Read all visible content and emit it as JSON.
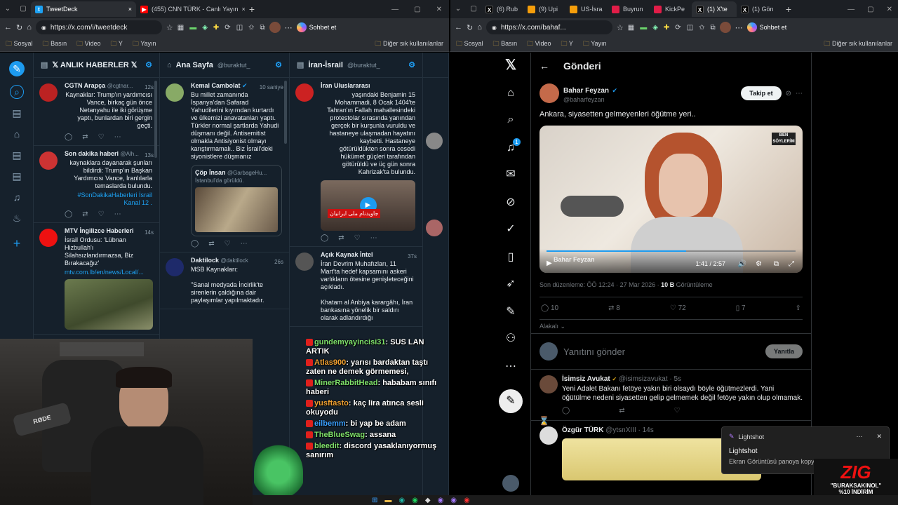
{
  "left_browser": {
    "tabs": [
      {
        "title": "TweetDeck",
        "active": true,
        "fav": "#1da1f2"
      },
      {
        "title": "(455) CNN TÜRK - Canlı Yayın",
        "active": false,
        "fav": "#ff0000"
      }
    ],
    "url": "https://x.com/i/tweetdeck",
    "copilot": "Sohbet et",
    "bookmarks": [
      "Sosyal",
      "Basın",
      "Video",
      "Y",
      "Yayın"
    ],
    "other_bookmarks": "Diğer sık kullanılanlar"
  },
  "right_browser": {
    "tabs": [
      {
        "title": "(6) Rub",
        "fav": "#000"
      },
      {
        "title": "(9) Upi",
        "fav": "#f59e0b"
      },
      {
        "title": "US-İsra",
        "fav": "#f59e0b"
      },
      {
        "title": "Buyrun",
        "fav": "#e11d48"
      },
      {
        "title": "KickPe",
        "fav": "#e11d48"
      },
      {
        "title": "(1) X'te",
        "fav": "#000"
      },
      {
        "title": "(1) Gön",
        "fav": "#000"
      }
    ],
    "url": "https://x.com/bahaf...",
    "copilot": "Sohbet et",
    "bookmarks": [
      "Sosyal",
      "Basın",
      "Video",
      "Y",
      "Yayın"
    ],
    "other_bookmarks": "Diğer sık kullanılanlar"
  },
  "tweetdeck": {
    "columns": [
      {
        "title": "ANLIK HABERLER",
        "handle": "",
        "tweets": [
          {
            "name": "CGTN Arapça",
            "handle": "@cgtnar...",
            "time": "12s",
            "text": "Kaynaklar: Trump'ın yardımcısı Vance, birkaç gün önce Netanyahu ile iki görüşme yaptı, bunlardan biri gergin geçti.",
            "rtl": true,
            "avatar": "#b22"
          },
          {
            "name": "Son dakika haberi",
            "handle": "@Alh...",
            "time": "13s",
            "text": "kaynaklara dayanarak şunları bildirdi: Trump'ın Başkan Yardımcısı Vance, İranlılarla temaslarda bulundu.",
            "link": "#SonDakikaHaberleri İsrail Kanal 12 .",
            "rtl": true,
            "avatar": "#c33"
          },
          {
            "name": "MTV İngilizce Haberleri",
            "handle": "...",
            "time": "14s",
            "text": "İsrail Ordusu: 'Lübnan Hizbullah'ı Silahsızlandırmazsa, Biz Bırakacağız'",
            "link": "mtv.com.lb/en/news/Local/...",
            "rtl": false,
            "avatar": "#e11"
          }
        ]
      },
      {
        "title": "Ana Sayfa",
        "handle": "@buraktut_",
        "tweets": [
          {
            "name": "Kemal Cambolat",
            "handle": "",
            "time": "10 saniye",
            "text": "Bu millet zamanında İspanya'dan Safarad Yahudilerini kıyımdan kurtardı ve ülkemizi anavatanları yaptı. Türkler normal şartlarda Yahudi düşmanı değil. Antisemitist olmakla Antisiyonist olmayı karıştırmamalı.. Biz İsrail'deki siyonistlere düşmanız",
            "rtl": false,
            "avatar": "#8a6"
          },
          {
            "name": "Daktilock",
            "handle": "@daktilock",
            "time": "26s",
            "text": "MSB Kaynakları:\n\n\"Sanal medyada İncirlik'te sirenlerin çaldığına dair paylaşımlar yapılmaktadır.",
            "rtl": false,
            "avatar": "#1e2a6a"
          }
        ],
        "quote": {
          "name": "Çöp İnsan",
          "handle": "@GarbageHu...",
          "text": "İstanbul'da görüldü."
        }
      },
      {
        "title": "İran-İsrail",
        "handle": "@buraktut_",
        "tweets": [
          {
            "name": "İran Uluslararası",
            "handle": "",
            "time": "",
            "text": "yaşındaki Benjamin 15 Mohammadi, 8 Ocak 1404'te Tahran'ın Fallah mahallesindeki protestolar sırasında yanından gerçek bir kurşunla vuruldu ve hastaneye ulaşmadan hayatını kaybetti. Hastaneye götürüldükten sonra cesedi hükümet güçleri tarafından götürüldü ve üç gün sonra Kahrizak'ta bulundu.",
            "rtl": true,
            "avatar": "#c22"
          },
          {
            "name": "Açık Kaynak İntel",
            "handle": "",
            "time": "37s",
            "text": "İran Devrim Muhafızları, 11 Mart'ta hedef kapsamını askeri varlıkların ötesine genişleteceğini açıkladı.\n\nKhatam al Anbiya karargâhı, İran bankasına yönelik bir saldırı olarak adlandırdığı",
            "rtl": false,
            "avatar": "#555"
          }
        ],
        "video_caption": "جاویدنام ملی ایرانیان"
      }
    ]
  },
  "chat": [
    {
      "user": "gundemyayincisi31",
      "msg": "SUS LAN ARTIK",
      "color": "#7ee06a"
    },
    {
      "user": "Atlas900",
      "msg": "yarısı bardaktan taştı zaten ne demek görmemesi,",
      "color": "#f0a030"
    },
    {
      "user": "MinerRabbitHead",
      "msg": "hababam sınıfı haberi",
      "color": "#7ee06a"
    },
    {
      "user": "yusftasto",
      "msg": "kaç lira atınca sesli okuyodu",
      "color": "#f0a030"
    },
    {
      "user": "eilbemm",
      "msg": "bi yap be adam",
      "color": "#3aa0ff"
    },
    {
      "user": "TheBlueSwag",
      "msg": "assana",
      "color": "#7ee06a"
    },
    {
      "user": "bleedit",
      "msg": "discord yasaklanıyormuş sanırım",
      "color": "#7ee06a"
    }
  ],
  "x_post": {
    "header": "Gönderi",
    "author": "Bahar Feyzan",
    "handle": "@baharfeyzan",
    "follow": "Takip et",
    "text": "Ankara, siyasetten gelmeyenleri öğütme yeri..",
    "video_time": "1:41 / 2:57",
    "watermark": "Bahar Feyzan",
    "edited": "Son düzenleme: ÖÖ 12:24 · 27 Mar 2026 · ",
    "views": "10 B",
    "views_label": "Görüntüleme",
    "replies": "10",
    "retweets": "8",
    "likes": "72",
    "bookmarks": "7",
    "relevant": "Alakalı",
    "reply_placeholder": "Yanıtını gönder",
    "reply_button": "Yanıtla",
    "notif_count": "1",
    "replies_list": [
      {
        "name": "İsimsiz Avukat",
        "handle": "@isimsizavukat · 5s",
        "text": "Yeni Adalet Bakanı fetöye yakın biri olsaydı böyle öğütmezlerdi. Yani öğütülme nedeni siyasetten gelip gelmemek değil fetöye yakın olup olmamak."
      },
      {
        "name": "Özgür TÜRK",
        "handle": "@ytsnXIII · 14s",
        "text": ""
      }
    ]
  },
  "notification": {
    "app": "Lightshot",
    "title": "Lightshot",
    "body": "Ekran Görüntüsü panoya kopyalandı"
  },
  "promo": {
    "logo": "ZIG",
    "code": "\"BURAKSAKINOL\"",
    "discount": "%10 İNDİRİM"
  }
}
